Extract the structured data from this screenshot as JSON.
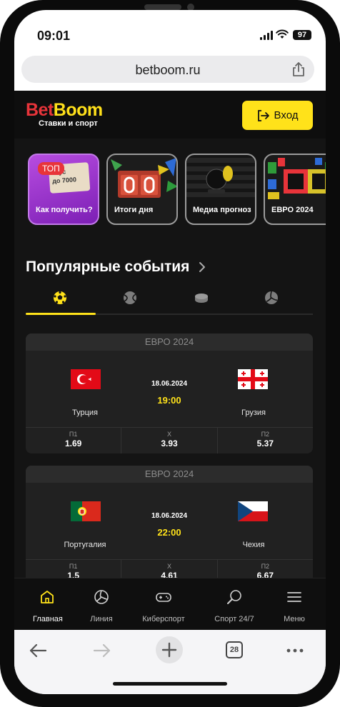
{
  "status": {
    "time": "09:01",
    "battery": "97"
  },
  "browser": {
    "url": "betboom.ru",
    "tabs_count": "28"
  },
  "header": {
    "logo_bet": "Bet",
    "logo_boom": "Boom",
    "tagline": "Ставки и спорт",
    "login_label": "Вход"
  },
  "stories": [
    {
      "label": "Как получить?",
      "badge": "ТОП",
      "promo_line1": "ус",
      "promo_line2": "до 7000"
    },
    {
      "label": "Итоги дня"
    },
    {
      "label": "Медиа прогноз"
    },
    {
      "label": "ЕВРО 2024"
    }
  ],
  "popular": {
    "title": "Популярные события"
  },
  "sport_tabs": [
    {
      "icon": "soccer-ball-icon",
      "active": true
    },
    {
      "icon": "tennis-ball-icon",
      "active": false
    },
    {
      "icon": "hockey-puck-icon",
      "active": false
    },
    {
      "icon": "volleyball-icon",
      "active": false
    }
  ],
  "events": [
    {
      "league": "ЕВРО 2024",
      "date": "18.06.2024",
      "time": "19:00",
      "home": "Турция",
      "away": "Грузия",
      "odds": [
        {
          "label": "П1",
          "value": "1.69"
        },
        {
          "label": "Х",
          "value": "3.93"
        },
        {
          "label": "П2",
          "value": "5.37"
        }
      ]
    },
    {
      "league": "ЕВРО 2024",
      "date": "18.06.2024",
      "time": "22:00",
      "home": "Португалия",
      "away": "Чехия",
      "odds": [
        {
          "label": "П1",
          "value": "1.5"
        },
        {
          "label": "Х",
          "value": "4.61"
        },
        {
          "label": "П2",
          "value": "6.67"
        }
      ]
    }
  ],
  "bottom_nav": [
    {
      "label": "Главная",
      "icon": "home-icon",
      "active": true
    },
    {
      "label": "Линия",
      "icon": "ball-icon",
      "active": false
    },
    {
      "label": "Киберспорт",
      "icon": "gamepad-icon",
      "active": false
    },
    {
      "label": "Спорт 24/7",
      "icon": "racket-icon",
      "active": false
    },
    {
      "label": "Меню",
      "icon": "menu-icon",
      "active": false
    }
  ],
  "colors": {
    "accent": "#ffe21a",
    "brand_red": "#e8343a",
    "background": "#141414"
  }
}
